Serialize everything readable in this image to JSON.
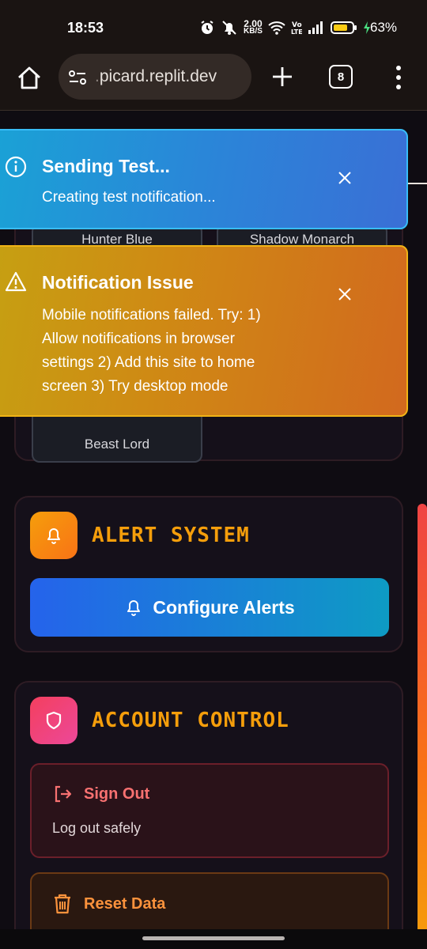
{
  "status_bar": {
    "time": "18:53",
    "net_speed_value": "2.00",
    "net_speed_unit": "KB/S",
    "volte": "Vo LTE",
    "battery": "63%",
    "icons": [
      "alarm-icon",
      "mute-icon",
      "wifi-icon",
      "signal-icon",
      "battery-icon",
      "charging-icon"
    ]
  },
  "browser": {
    "url_prefix": ".",
    "url_domain": "picard.replit.dev",
    "tab_count": "8"
  },
  "theme_card": {
    "buttons": [
      "Hunter Blue",
      "Shadow Monarch",
      "Beast Lord"
    ]
  },
  "alert_section": {
    "title": "ALERT SYSTEM",
    "button_label": "Configure Alerts"
  },
  "account_section": {
    "title": "ACCOUNT CONTROL",
    "sign_out_label": "Sign Out",
    "sign_out_desc": "Log out safely",
    "reset_label": "Reset Data"
  },
  "toasts": {
    "info": {
      "title": "Sending Test...",
      "message": "Creating test notification..."
    },
    "warning": {
      "title": "Notification Issue",
      "message_lines": [
        "Mobile notifications failed. Try: 1)",
        "Allow notifications in browser",
        "settings 2) Add this site to home",
        "screen 3) Try desktop mode"
      ]
    }
  },
  "colors": {
    "accent_title": "#f59e0b",
    "info_toast": "#2a86d8",
    "warning_toast": "#cf8a14",
    "configure_button": "#2563eb",
    "danger": "#f87171"
  }
}
